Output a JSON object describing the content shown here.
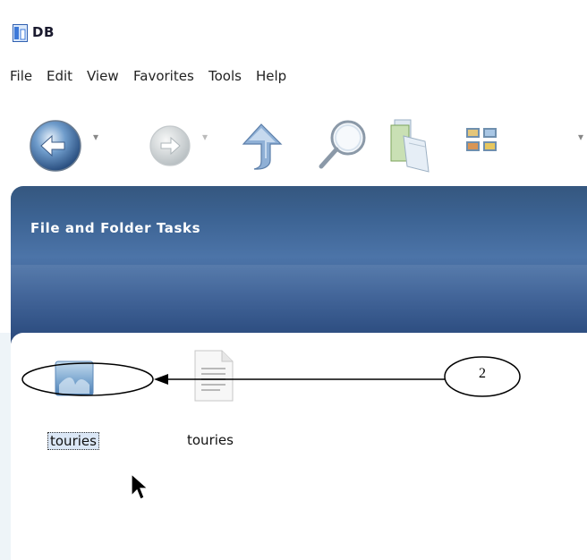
{
  "window": {
    "title": "DB"
  },
  "menu": {
    "items": [
      {
        "label": "File"
      },
      {
        "label": "Edit"
      },
      {
        "label": "View"
      },
      {
        "label": "Favorites"
      },
      {
        "label": "Tools"
      },
      {
        "label": "Help"
      }
    ]
  },
  "toolbar": {
    "buttons": [
      {
        "icon": "back-arrow-icon"
      },
      {
        "icon": "forward-arrow-icon"
      },
      {
        "icon": "up-folder-icon"
      },
      {
        "icon": "search-icon"
      },
      {
        "icon": "folders-icon"
      },
      {
        "icon": "views-icon"
      }
    ]
  },
  "task_pane": {
    "title": "File and Folder Tasks"
  },
  "files": [
    {
      "label": "touries",
      "type": "folder",
      "selected": true
    },
    {
      "label": "touries",
      "type": "document",
      "selected": false
    }
  ],
  "annotation": {
    "number": "2"
  }
}
